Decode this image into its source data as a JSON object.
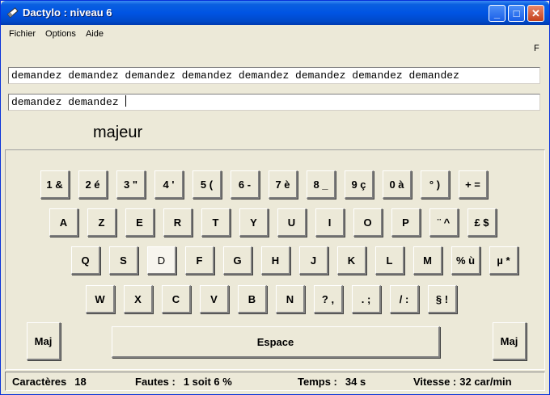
{
  "window": {
    "title": "Dactylo : niveau 6",
    "minimize": "_",
    "maximize": "□",
    "close": "✕",
    "icon": "pen-icon"
  },
  "menu": [
    "Fichier",
    "Options",
    "Aide"
  ],
  "flag": "F",
  "model_text": "demandez demandez demandez demandez demandez demandez demandez demandez",
  "typed_text": "demandez demandez ",
  "finger": "majeur",
  "keyboard": {
    "row1": [
      "1 &",
      "2 é",
      "3 \"",
      "4 '",
      "5 (",
      "6 -",
      "7 è",
      "8 _",
      "9 ç",
      "0 à",
      "° )",
      "+ ="
    ],
    "row2": [
      "A",
      "Z",
      "E",
      "R",
      "T",
      "Y",
      "U",
      "I",
      "O",
      "P",
      "¨ ^",
      "£ $"
    ],
    "row3": [
      "Q",
      "S",
      "D",
      "F",
      "G",
      "H",
      "J",
      "K",
      "L",
      "M",
      "% ù",
      "µ *"
    ],
    "row4": [
      "W",
      "X",
      "C",
      "V",
      "B",
      "N",
      "? ,",
      ". ;",
      "/ :",
      "§ !"
    ],
    "maj": "Maj",
    "space": "Espace",
    "active_key": "D"
  },
  "status": {
    "chars_label": "Caractères",
    "chars_value": "18",
    "faults_label": "Fautes :",
    "faults_value": "1 soit 6 %",
    "time_label": "Temps :",
    "time_value": "34 s",
    "speed_label": "Vitesse :",
    "speed_value": "32 car/min"
  }
}
